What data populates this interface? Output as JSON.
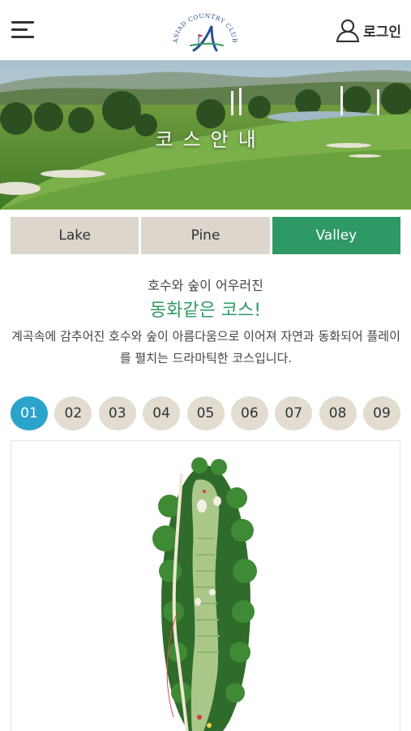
{
  "header": {
    "logo_text": "ASIAD COUNTRY CLUB",
    "login_label": "로그인"
  },
  "hero": {
    "title": "코스안내"
  },
  "tabs": [
    {
      "label": "Lake",
      "active": false
    },
    {
      "label": "Pine",
      "active": false
    },
    {
      "label": "Valley",
      "active": true
    }
  ],
  "intro": {
    "subtitle": "호수와 숲이 어우러진",
    "title": "동화같은 코스!",
    "description": "계곡속에 감추어진 호수와 숲이 아름다움으로 이어져 자연과 동화되어 플레이를 펼치는 드라마틱한 코스입니다."
  },
  "holes": [
    {
      "label": "01",
      "active": true
    },
    {
      "label": "02",
      "active": false
    },
    {
      "label": "03",
      "active": false
    },
    {
      "label": "04",
      "active": false
    },
    {
      "label": "05",
      "active": false
    },
    {
      "label": "06",
      "active": false
    },
    {
      "label": "07",
      "active": false
    },
    {
      "label": "08",
      "active": false
    },
    {
      "label": "09",
      "active": false
    }
  ],
  "colors": {
    "accent_green": "#2e9966",
    "hole_active": "#2ba3cb",
    "tab_inactive": "#ddd6cc",
    "hole_inactive": "#e2dcd1"
  }
}
